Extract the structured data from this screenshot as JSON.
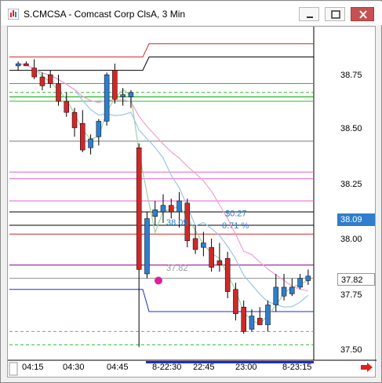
{
  "window": {
    "title": "S.CMCSA - Comcast Corp ClsA, 3 Min"
  },
  "controls": [
    "minimize-button",
    "maximize-button",
    "close-button"
  ],
  "price_axis": {
    "ticks": [
      "38.75",
      "38.50",
      "38.25",
      "38.00",
      "37.75",
      "37.50"
    ],
    "current_price": "38.09",
    "last_price": "37.82"
  },
  "time_axis": {
    "labels": [
      "04:15",
      "04:30",
      "04:45",
      "8-22:30",
      "22:45",
      "23:00",
      "8-23:15"
    ]
  },
  "annotations": {
    "change_value": "$0.27",
    "change_percent": "0.71 %",
    "price_38_09": "38.09",
    "price_37_82": "37.82"
  },
  "colors": {
    "bull": "#2f7ecb",
    "bear": "#d02828",
    "accent_label": "#2f7ecb",
    "title_bg": "#ffffff",
    "close_button": "#c75050"
  },
  "chart_data": {
    "type": "candlestick",
    "ylim": [
      37.45,
      38.95
    ],
    "candles": [
      {
        "o": 38.78,
        "h": 38.8,
        "l": 38.76,
        "c": 38.79
      },
      {
        "o": 38.79,
        "h": 38.8,
        "l": 38.78,
        "c": 38.78
      },
      {
        "o": 38.77,
        "h": 38.81,
        "l": 38.72,
        "c": 38.73
      },
      {
        "o": 38.73,
        "h": 38.75,
        "l": 38.67,
        "c": 38.69
      },
      {
        "o": 38.74,
        "h": 38.76,
        "l": 38.68,
        "c": 38.7
      },
      {
        "o": 38.7,
        "h": 38.74,
        "l": 38.6,
        "c": 38.62
      },
      {
        "o": 38.62,
        "h": 38.66,
        "l": 38.55,
        "c": 38.57
      },
      {
        "o": 38.57,
        "h": 38.59,
        "l": 38.46,
        "c": 38.5
      },
      {
        "o": 38.52,
        "h": 38.58,
        "l": 38.39,
        "c": 38.4
      },
      {
        "o": 38.41,
        "h": 38.47,
        "l": 38.38,
        "c": 38.45
      },
      {
        "o": 38.46,
        "h": 38.54,
        "l": 38.42,
        "c": 38.53
      },
      {
        "o": 38.53,
        "h": 38.75,
        "l": 38.51,
        "c": 38.74
      },
      {
        "o": 38.76,
        "h": 38.79,
        "l": 38.61,
        "c": 38.63
      },
      {
        "o": 38.64,
        "h": 38.68,
        "l": 38.6,
        "c": 38.65
      },
      {
        "o": 38.64,
        "h": 38.67,
        "l": 38.59,
        "c": 38.66
      },
      {
        "o": 38.41,
        "h": 38.43,
        "l": 37.51,
        "c": 37.86
      },
      {
        "o": 37.84,
        "h": 38.12,
        "l": 37.82,
        "c": 38.09
      },
      {
        "o": 38.1,
        "h": 38.17,
        "l": 38.06,
        "c": 38.13
      },
      {
        "o": 38.12,
        "h": 38.2,
        "l": 38.07,
        "c": 38.15
      },
      {
        "o": 38.15,
        "h": 38.18,
        "l": 38.09,
        "c": 38.12
      },
      {
        "o": 38.12,
        "h": 38.21,
        "l": 38.05,
        "c": 38.17
      },
      {
        "o": 38.16,
        "h": 38.18,
        "l": 37.96,
        "c": 37.99
      },
      {
        "o": 38.0,
        "h": 38.06,
        "l": 37.93,
        "c": 37.95
      },
      {
        "o": 37.96,
        "h": 38.03,
        "l": 37.92,
        "c": 37.98
      },
      {
        "o": 37.96,
        "h": 38.0,
        "l": 37.85,
        "c": 37.87
      },
      {
        "o": 37.9,
        "h": 37.98,
        "l": 37.85,
        "c": 37.88
      },
      {
        "o": 37.91,
        "h": 37.94,
        "l": 37.73,
        "c": 37.76
      },
      {
        "o": 37.77,
        "h": 37.8,
        "l": 37.63,
        "c": 37.66
      },
      {
        "o": 37.69,
        "h": 37.72,
        "l": 37.57,
        "c": 37.58
      },
      {
        "o": 37.59,
        "h": 37.68,
        "l": 37.58,
        "c": 37.65
      },
      {
        "o": 37.64,
        "h": 37.69,
        "l": 37.61,
        "c": 37.61
      },
      {
        "o": 37.61,
        "h": 37.72,
        "l": 37.58,
        "c": 37.7
      },
      {
        "o": 37.7,
        "h": 37.84,
        "l": 37.67,
        "c": 37.78
      },
      {
        "o": 37.74,
        "h": 37.84,
        "l": 37.72,
        "c": 37.78
      },
      {
        "o": 37.75,
        "h": 37.82,
        "l": 37.74,
        "c": 37.78
      },
      {
        "o": 37.78,
        "h": 37.84,
        "l": 37.77,
        "c": 37.82
      },
      {
        "o": 37.81,
        "h": 37.86,
        "l": 37.79,
        "c": 37.83
      }
    ],
    "levels": [
      {
        "price": 38.88,
        "color": "#d02828",
        "style": "solid",
        "pre": 38.82
      },
      {
        "price": 38.82,
        "color": "#000000",
        "style": "solid",
        "pre": 38.76
      },
      {
        "price": 38.7,
        "color": "#2eb82e",
        "style": "solid",
        "pre": 38.7
      },
      {
        "price": 38.66,
        "color": "#2eb82e",
        "style": "dash",
        "pre": 38.66
      },
      {
        "price": 38.64,
        "color": "#00a000",
        "style": "solid",
        "pre": 38.64
      },
      {
        "price": 38.62,
        "color": "#2eb82e",
        "style": "solid",
        "pre": 38.62
      },
      {
        "price": 38.44,
        "color": "#777777",
        "style": "solid",
        "pre": 38.44
      },
      {
        "price": 38.3,
        "color": "#e060d0",
        "style": "solid",
        "pre": 38.3
      },
      {
        "price": 38.27,
        "color": "#e060d0",
        "style": "solid",
        "pre": 38.27
      },
      {
        "price": 38.17,
        "color": "#e060d0",
        "style": "solid",
        "pre": 38.17
      },
      {
        "price": 38.12,
        "color": "#000000",
        "style": "solid",
        "pre": 38.12
      },
      {
        "price": 38.06,
        "color": "#000000",
        "style": "solid",
        "pre": 38.06
      },
      {
        "price": 38.02,
        "color": "#d02828",
        "style": "solid",
        "pre": 38.02
      },
      {
        "price": 37.88,
        "color": "#800080",
        "style": "solid",
        "pre": 37.88
      },
      {
        "price": 37.82,
        "color": "#909090",
        "style": "solid",
        "pre": 37.82
      },
      {
        "price": 37.67,
        "color": "#1f2bd0",
        "style": "solid",
        "pre": 37.77
      },
      {
        "price": 37.58,
        "color": "#e060d0",
        "style": "dash",
        "pre": 37.58
      },
      {
        "price": 37.52,
        "color": "#2eb82e",
        "style": "dash",
        "pre": 37.52
      }
    ]
  }
}
